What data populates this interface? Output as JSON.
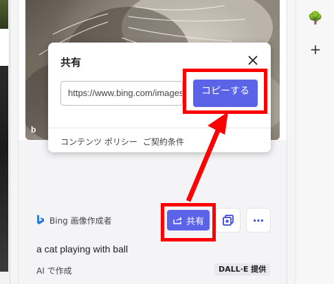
{
  "dialog": {
    "title": "共有",
    "url_value": "https://www.bing.com/images/create",
    "copy_label": "コピーする",
    "links": [
      "コンテンツ ポリシー",
      "ご契約条件"
    ]
  },
  "card": {
    "creator_label": "Bing 画像作成者",
    "share_label": "共有",
    "more_label": "…",
    "prompt": "a cat playing with ball",
    "ai_label": "AI で作成",
    "badge": "DALL·E 提供",
    "image_watermark": "b"
  },
  "sidebar": {
    "items": [
      {
        "icon": "tree-icon",
        "glyph": "🌳"
      },
      {
        "icon": "plus-icon",
        "glyph": "+"
      }
    ]
  },
  "colors": {
    "accent": "#5b63e8",
    "highlight": "#ff0000"
  }
}
